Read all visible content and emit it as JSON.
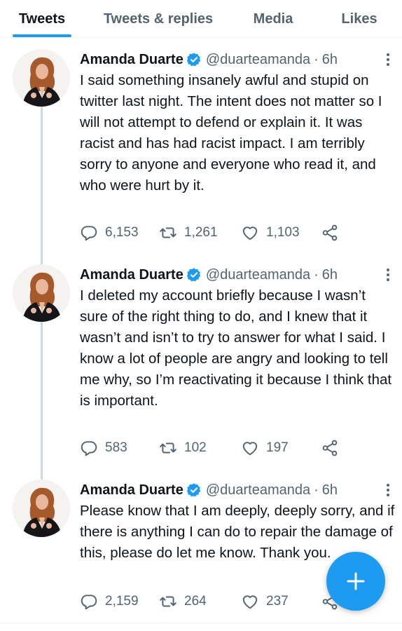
{
  "tabs": [
    {
      "label": "Tweets",
      "active": true
    },
    {
      "label": "Tweets & replies",
      "active": false
    },
    {
      "label": "Media",
      "active": false
    },
    {
      "label": "Likes",
      "active": false
    }
  ],
  "colors": {
    "accent": "#1d9bf0",
    "text": "#0f1419",
    "muted": "#536471"
  },
  "tweets": [
    {
      "name": "Amanda Duarte",
      "handle": "@duarteamanda",
      "separator": "·",
      "time": "6h",
      "text": "I said something insanely awful and stupid on twitter last night. The intent does not matter so I will not attempt to defend or explain it. It was racist and has had racist impact. I am terribly sorry to anyone and everyone who read it, and who were hurt by it.",
      "replies": "6,153",
      "retweets": "1,261",
      "likes": "1,103"
    },
    {
      "name": "Amanda Duarte",
      "handle": "@duarteamanda",
      "separator": "·",
      "time": "6h",
      "text": "I deleted my account briefly because I wasn’t sure of the right thing to do, and I knew that it wasn’t and isn’t to try to answer for what I said. I know a lot of people are angry and looking to tell me why, so I’m reactivating it because I think that is important.",
      "replies": "583",
      "retweets": "102",
      "likes": "197"
    },
    {
      "name": "Amanda Duarte",
      "handle": "@duarteamanda",
      "separator": "·",
      "time": "6h",
      "text": "Please know that I am deeply, deeply sorry, and if there is anything I can do to repair the damage of this, please do let me know. Thank you.",
      "replies": "2,159",
      "retweets": "264",
      "likes": "237"
    }
  ],
  "icons": {
    "verified": "verified-badge-icon",
    "more": "more-vertical-icon",
    "reply": "reply-icon",
    "retweet": "retweet-icon",
    "like": "like-icon",
    "share": "share-icon",
    "compose": "plus-icon"
  }
}
